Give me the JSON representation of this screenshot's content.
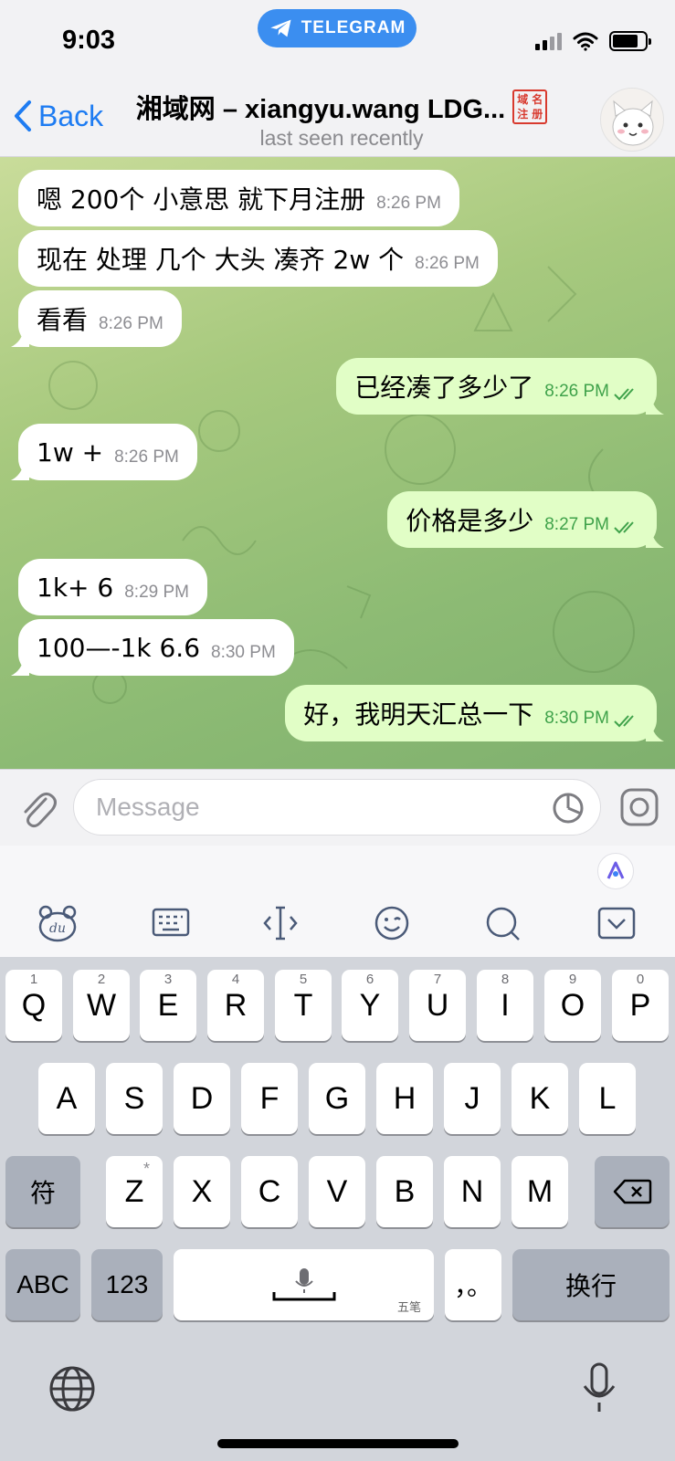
{
  "status_bar": {
    "time": "9:03",
    "app_pill": "TELEGRAM"
  },
  "header": {
    "back_label": "Back",
    "title": "湘域网 – xiangyu.wang LDG...",
    "seal_chars": [
      "域",
      "名",
      "注",
      "册"
    ],
    "subtitle": "last seen recently"
  },
  "messages": [
    {
      "dir": "in",
      "text": "嗯  200个  小意思  就下月注册",
      "time": "8:26 PM"
    },
    {
      "dir": "in",
      "text": "现在 处理 几个 大头 凑齐  2w 个",
      "time": "8:26 PM"
    },
    {
      "dir": "in",
      "text": "看看",
      "time": "8:26 PM"
    },
    {
      "dir": "out",
      "text": "已经凑了多少了",
      "time": "8:26 PM"
    },
    {
      "dir": "in",
      "text": "1w +",
      "time": "8:26 PM"
    },
    {
      "dir": "out",
      "text": "价格是多少",
      "time": "8:27 PM"
    },
    {
      "dir": "in",
      "text": "1k+  6",
      "time": "8:29 PM"
    },
    {
      "dir": "in",
      "text": "100—-1k   6.6",
      "time": "8:30 PM"
    },
    {
      "dir": "out",
      "text": "好，我明天汇总一下",
      "time": "8:30 PM"
    }
  ],
  "input": {
    "placeholder": "Message"
  },
  "keyboard": {
    "row1": [
      {
        "label": "Q",
        "num": "1"
      },
      {
        "label": "W",
        "num": "2"
      },
      {
        "label": "E",
        "num": "3"
      },
      {
        "label": "R",
        "num": "4"
      },
      {
        "label": "T",
        "num": "5"
      },
      {
        "label": "Y",
        "num": "6"
      },
      {
        "label": "U",
        "num": "7"
      },
      {
        "label": "I",
        "num": "8"
      },
      {
        "label": "O",
        "num": "9"
      },
      {
        "label": "P",
        "num": "0"
      }
    ],
    "row2": [
      "A",
      "S",
      "D",
      "F",
      "G",
      "H",
      "J",
      "K",
      "L"
    ],
    "row3": [
      "Z",
      "X",
      "C",
      "V",
      "B",
      "N",
      "M"
    ],
    "symbol_key": "符",
    "z_star": "*",
    "abc_key": "ABC",
    "num_key": "123",
    "space_sub": "五笔",
    "punct_key": "，。",
    "return_key": "换行"
  }
}
